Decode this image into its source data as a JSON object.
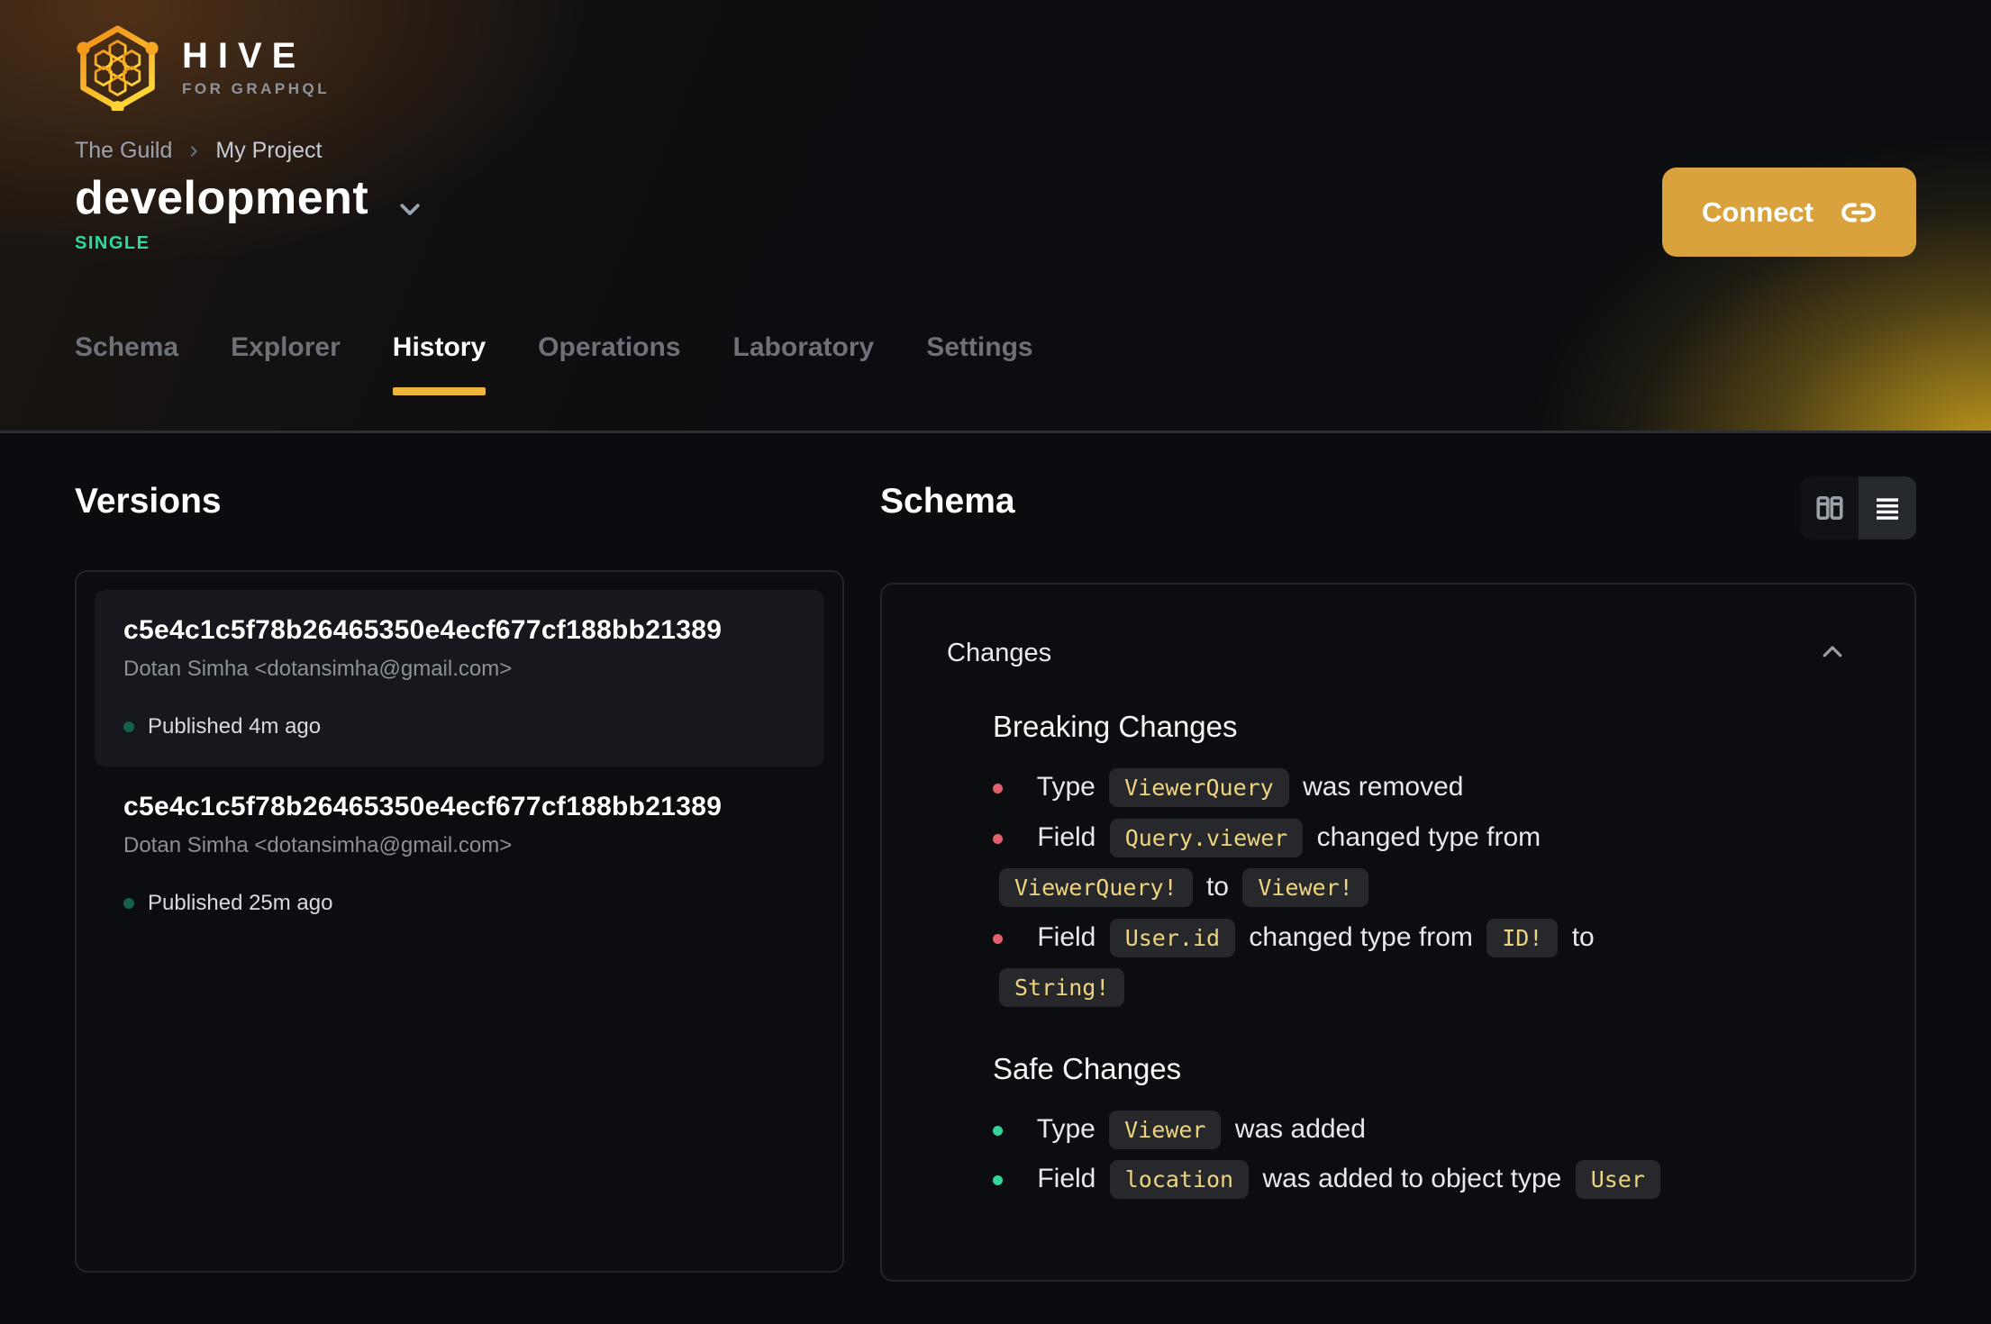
{
  "brand": {
    "name": "HIVE",
    "tagline": "FOR GRAPHQL"
  },
  "breadcrumb": {
    "org": "The Guild",
    "project": "My Project"
  },
  "target": {
    "name": "development",
    "badge": "SINGLE"
  },
  "header": {
    "connect_label": "Connect"
  },
  "tabs": [
    {
      "label": "Schema",
      "active": false
    },
    {
      "label": "Explorer",
      "active": false
    },
    {
      "label": "History",
      "active": true
    },
    {
      "label": "Operations",
      "active": false
    },
    {
      "label": "Laboratory",
      "active": false
    },
    {
      "label": "Settings",
      "active": false
    }
  ],
  "versions": {
    "heading": "Versions",
    "items": [
      {
        "hash": "c5e4c1c5f78b26465350e4ecf677cf188bb21389",
        "author": "Dotan Simha <dotansimha@gmail.com>",
        "status": "Published 4m ago",
        "selected": true
      },
      {
        "hash": "c5e4c1c5f78b26465350e4ecf677cf188bb21389",
        "author": "Dotan Simha <dotansimha@gmail.com>",
        "status": "Published 25m ago",
        "selected": false
      }
    ]
  },
  "schema_panel": {
    "heading": "Schema",
    "view_toggle": [
      {
        "icon": "columns-icon",
        "active": false
      },
      {
        "icon": "rows-icon",
        "active": true
      }
    ],
    "changes": {
      "title": "Changes",
      "sections": [
        {
          "title": "Breaking Changes",
          "severity": "breaking",
          "items": [
            {
              "parts": [
                {
                  "t": "text",
                  "v": "Type"
                },
                {
                  "t": "code",
                  "v": "ViewerQuery"
                },
                {
                  "t": "text",
                  "v": "was removed"
                }
              ]
            },
            {
              "parts": [
                {
                  "t": "text",
                  "v": "Field"
                },
                {
                  "t": "code",
                  "v": "Query.viewer"
                },
                {
                  "t": "text",
                  "v": "changed type from"
                },
                {
                  "t": "code",
                  "v": "ViewerQuery!"
                },
                {
                  "t": "text",
                  "v": "to"
                },
                {
                  "t": "code",
                  "v": "Viewer!"
                }
              ]
            },
            {
              "parts": [
                {
                  "t": "text",
                  "v": "Field"
                },
                {
                  "t": "code",
                  "v": "User.id"
                },
                {
                  "t": "text",
                  "v": "changed type from"
                },
                {
                  "t": "code",
                  "v": "ID!"
                },
                {
                  "t": "text",
                  "v": "to"
                },
                {
                  "t": "code",
                  "v": "String!"
                }
              ]
            }
          ]
        },
        {
          "title": "Safe Changes",
          "severity": "safe",
          "items": [
            {
              "parts": [
                {
                  "t": "text",
                  "v": "Type"
                },
                {
                  "t": "code",
                  "v": "Viewer"
                },
                {
                  "t": "text",
                  "v": "was added"
                }
              ]
            },
            {
              "parts": [
                {
                  "t": "text",
                  "v": "Field"
                },
                {
                  "t": "code",
                  "v": "location"
                },
                {
                  "t": "text",
                  "v": "was added to object type"
                },
                {
                  "t": "code",
                  "v": "User"
                }
              ]
            }
          ]
        }
      ]
    }
  },
  "colors": {
    "accent_button": "#d9a23c",
    "tab_underline": "#edb43c",
    "badge_green": "#31d99e",
    "breaking_bullet": "#e0616e",
    "safe_bullet": "#34d399",
    "code_text": "#eed47f",
    "published_dot": "#2ee0a4"
  }
}
